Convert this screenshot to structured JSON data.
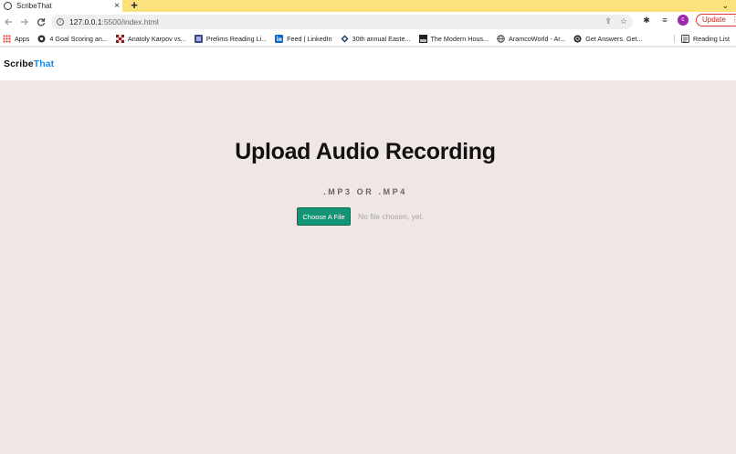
{
  "browser": {
    "tab": {
      "title": "ScribeThat",
      "close": "×"
    },
    "new_tab": "+",
    "tab_search": "⌄",
    "address": {
      "host": "127.0.0.1",
      "path": ":5500/index.html"
    },
    "update_label": "Update",
    "profile_initial": "c",
    "bookmarks": [
      {
        "label": "Apps",
        "icon": "apps-grid-icon"
      },
      {
        "label": "4 Goal Scoring an...",
        "icon": "globe-dark-icon"
      },
      {
        "label": "Anatoly Karpov vs...",
        "icon": "chess-icon"
      },
      {
        "label": "Prelims Reading Li...",
        "icon": "book-icon"
      },
      {
        "label": "Feed | LinkedIn",
        "icon": "linkedin-icon"
      },
      {
        "label": "30th annual Easte...",
        "icon": "diamond-icon"
      },
      {
        "label": "The Modern Hous...",
        "icon": "house-icon"
      },
      {
        "label": "AramcoWorld - Ar...",
        "icon": "globe-icon"
      },
      {
        "label": "Get Answers. Get...",
        "icon": "answers-icon"
      }
    ],
    "reading_list": "Reading List"
  },
  "site": {
    "logo_part1": "Scribe",
    "logo_part2": "That"
  },
  "main": {
    "heading": "Upload Audio Recording",
    "formats": ".MP3 OR .MP4",
    "choose_button": "Choose A File",
    "file_status": "No file chosen, yet."
  },
  "colors": {
    "tabstrip": "#fbe27d",
    "page_background": "#f0e6e4",
    "accent_button": "#149477",
    "logo_accent": "#1e88e5",
    "update_red": "#c62828"
  }
}
